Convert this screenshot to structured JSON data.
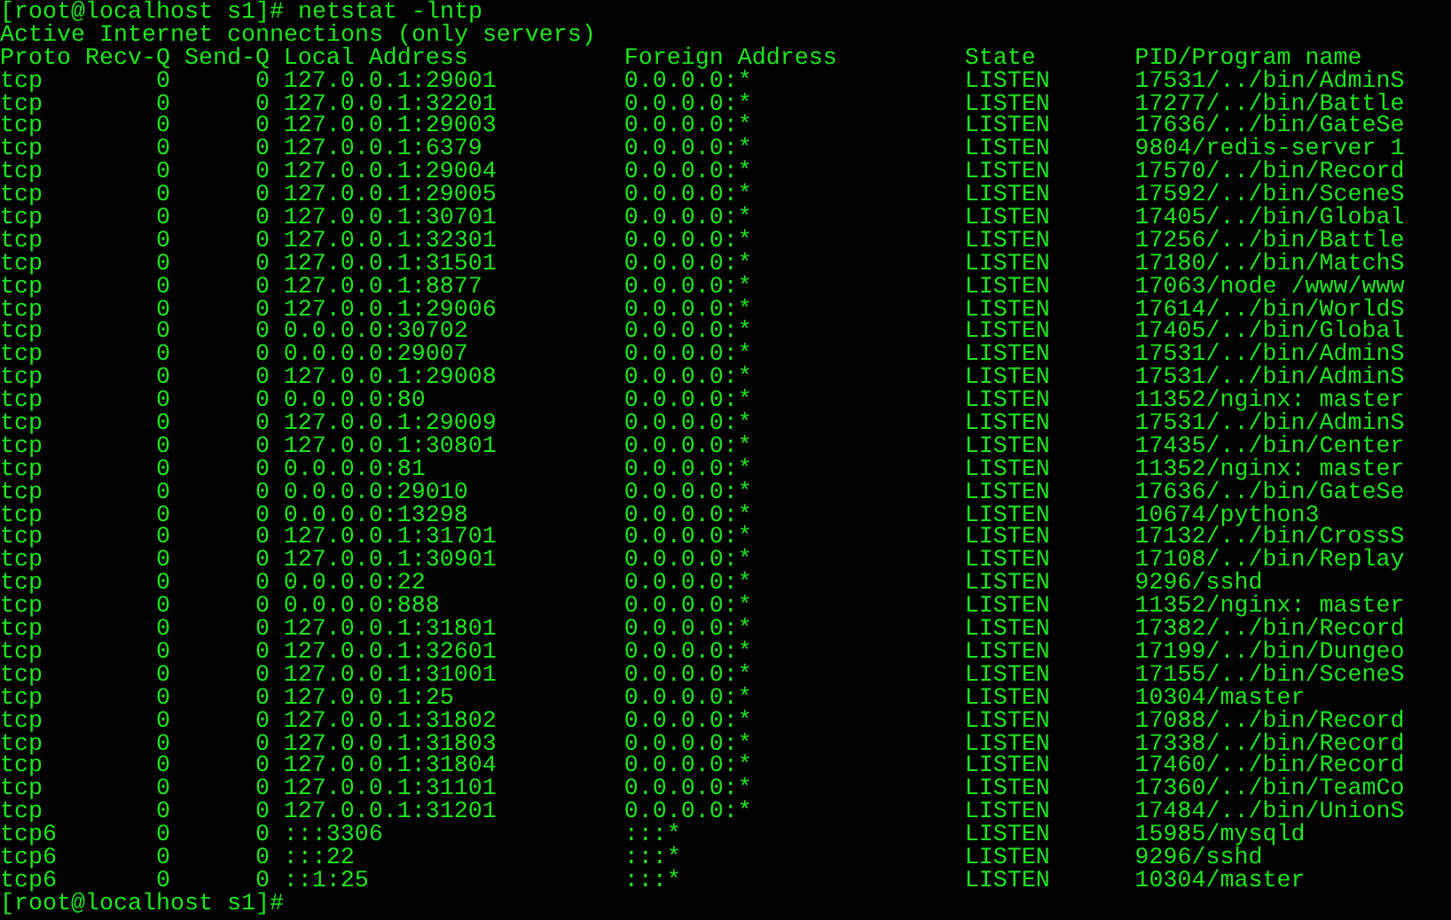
{
  "command_prompt": "[root@localhost s1]# netstat -lntp",
  "title_line": "Active Internet connections (only servers)",
  "columns": [
    "Proto",
    "Recv-Q",
    "Send-Q",
    "Local Address",
    "Foreign Address",
    "State",
    "PID/Program name"
  ],
  "rows": [
    [
      "tcp",
      "0",
      "0",
      "127.0.0.1:29001",
      "0.0.0.0:*",
      "LISTEN",
      "17531/../bin/AdminS"
    ],
    [
      "tcp",
      "0",
      "0",
      "127.0.0.1:32201",
      "0.0.0.0:*",
      "LISTEN",
      "17277/../bin/Battle"
    ],
    [
      "tcp",
      "0",
      "0",
      "127.0.0.1:29003",
      "0.0.0.0:*",
      "LISTEN",
      "17636/../bin/GateSe"
    ],
    [
      "tcp",
      "0",
      "0",
      "127.0.0.1:6379",
      "0.0.0.0:*",
      "LISTEN",
      "9804/redis-server 1"
    ],
    [
      "tcp",
      "0",
      "0",
      "127.0.0.1:29004",
      "0.0.0.0:*",
      "LISTEN",
      "17570/../bin/Record"
    ],
    [
      "tcp",
      "0",
      "0",
      "127.0.0.1:29005",
      "0.0.0.0:*",
      "LISTEN",
      "17592/../bin/SceneS"
    ],
    [
      "tcp",
      "0",
      "0",
      "127.0.0.1:30701",
      "0.0.0.0:*",
      "LISTEN",
      "17405/../bin/Global"
    ],
    [
      "tcp",
      "0",
      "0",
      "127.0.0.1:32301",
      "0.0.0.0:*",
      "LISTEN",
      "17256/../bin/Battle"
    ],
    [
      "tcp",
      "0",
      "0",
      "127.0.0.1:31501",
      "0.0.0.0:*",
      "LISTEN",
      "17180/../bin/MatchS"
    ],
    [
      "tcp",
      "0",
      "0",
      "127.0.0.1:8877",
      "0.0.0.0:*",
      "LISTEN",
      "17063/node /www/www"
    ],
    [
      "tcp",
      "0",
      "0",
      "127.0.0.1:29006",
      "0.0.0.0:*",
      "LISTEN",
      "17614/../bin/WorldS"
    ],
    [
      "tcp",
      "0",
      "0",
      "0.0.0.0:30702",
      "0.0.0.0:*",
      "LISTEN",
      "17405/../bin/Global"
    ],
    [
      "tcp",
      "0",
      "0",
      "0.0.0.0:29007",
      "0.0.0.0:*",
      "LISTEN",
      "17531/../bin/AdminS"
    ],
    [
      "tcp",
      "0",
      "0",
      "127.0.0.1:29008",
      "0.0.0.0:*",
      "LISTEN",
      "17531/../bin/AdminS"
    ],
    [
      "tcp",
      "0",
      "0",
      "0.0.0.0:80",
      "0.0.0.0:*",
      "LISTEN",
      "11352/nginx: master"
    ],
    [
      "tcp",
      "0",
      "0",
      "127.0.0.1:29009",
      "0.0.0.0:*",
      "LISTEN",
      "17531/../bin/AdminS"
    ],
    [
      "tcp",
      "0",
      "0",
      "127.0.0.1:30801",
      "0.0.0.0:*",
      "LISTEN",
      "17435/../bin/Center"
    ],
    [
      "tcp",
      "0",
      "0",
      "0.0.0.0:81",
      "0.0.0.0:*",
      "LISTEN",
      "11352/nginx: master"
    ],
    [
      "tcp",
      "0",
      "0",
      "0.0.0.0:29010",
      "0.0.0.0:*",
      "LISTEN",
      "17636/../bin/GateSe"
    ],
    [
      "tcp",
      "0",
      "0",
      "0.0.0.0:13298",
      "0.0.0.0:*",
      "LISTEN",
      "10674/python3"
    ],
    [
      "tcp",
      "0",
      "0",
      "127.0.0.1:31701",
      "0.0.0.0:*",
      "LISTEN",
      "17132/../bin/CrossS"
    ],
    [
      "tcp",
      "0",
      "0",
      "127.0.0.1:30901",
      "0.0.0.0:*",
      "LISTEN",
      "17108/../bin/Replay"
    ],
    [
      "tcp",
      "0",
      "0",
      "0.0.0.0:22",
      "0.0.0.0:*",
      "LISTEN",
      "9296/sshd"
    ],
    [
      "tcp",
      "0",
      "0",
      "0.0.0.0:888",
      "0.0.0.0:*",
      "LISTEN",
      "11352/nginx: master"
    ],
    [
      "tcp",
      "0",
      "0",
      "127.0.0.1:31801",
      "0.0.0.0:*",
      "LISTEN",
      "17382/../bin/Record"
    ],
    [
      "tcp",
      "0",
      "0",
      "127.0.0.1:32601",
      "0.0.0.0:*",
      "LISTEN",
      "17199/../bin/Dungeo"
    ],
    [
      "tcp",
      "0",
      "0",
      "127.0.0.1:31001",
      "0.0.0.0:*",
      "LISTEN",
      "17155/../bin/SceneS"
    ],
    [
      "tcp",
      "0",
      "0",
      "127.0.0.1:25",
      "0.0.0.0:*",
      "LISTEN",
      "10304/master"
    ],
    [
      "tcp",
      "0",
      "0",
      "127.0.0.1:31802",
      "0.0.0.0:*",
      "LISTEN",
      "17088/../bin/Record"
    ],
    [
      "tcp",
      "0",
      "0",
      "127.0.0.1:31803",
      "0.0.0.0:*",
      "LISTEN",
      "17338/../bin/Record"
    ],
    [
      "tcp",
      "0",
      "0",
      "127.0.0.1:31804",
      "0.0.0.0:*",
      "LISTEN",
      "17460/../bin/Record"
    ],
    [
      "tcp",
      "0",
      "0",
      "127.0.0.1:31101",
      "0.0.0.0:*",
      "LISTEN",
      "17360/../bin/TeamCo"
    ],
    [
      "tcp",
      "0",
      "0",
      "127.0.0.1:31201",
      "0.0.0.0:*",
      "LISTEN",
      "17484/../bin/UnionS"
    ],
    [
      "tcp6",
      "0",
      "0",
      ":::3306",
      ":::*",
      "LISTEN",
      "15985/mysqld"
    ],
    [
      "tcp6",
      "0",
      "0",
      ":::22",
      ":::*",
      "LISTEN",
      "9296/sshd"
    ],
    [
      "tcp6",
      "0",
      "0",
      "::1:25",
      ":::*",
      "LISTEN",
      "10304/master"
    ]
  ],
  "final_prompt": "[root@localhost s1]#"
}
